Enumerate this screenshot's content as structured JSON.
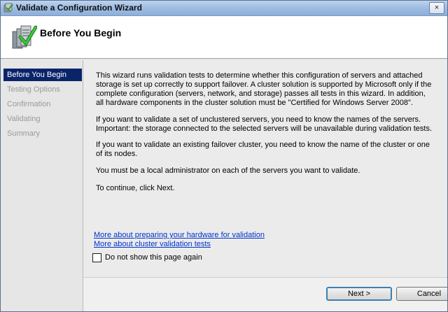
{
  "window": {
    "title": "Validate a Configuration Wizard",
    "close_glyph": "×"
  },
  "header": {
    "title": "Before You Begin"
  },
  "steps": [
    {
      "label": "Before You Begin",
      "active": true
    },
    {
      "label": "Testing Options",
      "active": false
    },
    {
      "label": "Confirmation",
      "active": false
    },
    {
      "label": "Validating",
      "active": false
    },
    {
      "label": "Summary",
      "active": false
    }
  ],
  "content": {
    "paragraphs": [
      "This wizard runs validation tests to determine whether this configuration of servers and attached storage is set up correctly to support failover. A cluster solution is supported by Microsoft only if the complete configuration (servers, network, and storage) passes all tests in this wizard. In addition, all hardware components in the cluster solution must be \"Certified for Windows Server 2008\".",
      "If you want to validate a set of unclustered servers, you need to know the names of the servers. Important: the storage connected to the selected servers will be unavailable during validation tests.",
      "If you want to validate an existing failover cluster, you need to know the name of the cluster or one of its nodes.",
      "You must be a local administrator on each of the servers you want to validate.",
      "To continue, click Next."
    ],
    "links": [
      "More about preparing your hardware for validation",
      "More about cluster validation tests"
    ],
    "checkbox_label": "Do not show this page again",
    "checkbox_checked": false
  },
  "buttons": {
    "next": "Next >",
    "cancel": "Cancel"
  },
  "colors": {
    "active_step_bg": "#0a246a",
    "link": "#0033cc",
    "icon_check": "#2e9e2e"
  },
  "icons": {
    "title": "wizard-check-icon",
    "header": "server-check-icon"
  }
}
